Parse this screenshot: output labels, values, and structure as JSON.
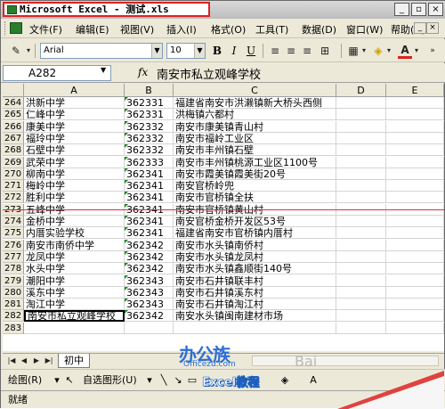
{
  "window": {
    "title": "Microsoft Excel - 测试.xls",
    "minimize": "_",
    "restore": "▫",
    "close": "×"
  },
  "menu": {
    "items": [
      {
        "label": "文件(F)"
      },
      {
        "label": "编辑(E)"
      },
      {
        "label": "视图(V)"
      },
      {
        "label": "插入(I)"
      },
      {
        "label": "格式(O)"
      },
      {
        "label": "工具(T)"
      },
      {
        "label": "数据(D)"
      },
      {
        "label": "窗口(W)"
      },
      {
        "label": "帮助(H)"
      }
    ]
  },
  "toolbar": {
    "font_name": "Arial",
    "font_size": "10",
    "bold": "B",
    "italic": "I",
    "underline": "U",
    "font_color_letter": "A"
  },
  "formula_bar": {
    "name_box": "A282",
    "fx_label": "fx",
    "formula": "南安市私立观峰学校"
  },
  "columns": [
    "A",
    "B",
    "C",
    "D",
    "E"
  ],
  "rows": [
    {
      "n": "264",
      "a": "洪新中学",
      "b": "362331",
      "c": "福建省南安市洪濑镇新大桥头西侧"
    },
    {
      "n": "265",
      "a": "仁峰中学",
      "b": "362331",
      "c": "洪梅镇六都村"
    },
    {
      "n": "266",
      "a": "康美中学",
      "b": "362332",
      "c": "南安市康美镇青山村"
    },
    {
      "n": "267",
      "a": "福玲中学",
      "b": "362332",
      "c": "南安市福岭工业区"
    },
    {
      "n": "268",
      "a": "石壁中学",
      "b": "362332",
      "c": "南安市丰州镇石壁"
    },
    {
      "n": "269",
      "a": "武荣中学",
      "b": "362333",
      "c": "南安市丰州镇桃源工业区1100号"
    },
    {
      "n": "270",
      "a": "柳南中学",
      "b": "362341",
      "c": "南安市霞美镇霞美街20号"
    },
    {
      "n": "271",
      "a": "梅岭中学",
      "b": "362341",
      "c": "南安官桥岭兜"
    },
    {
      "n": "272",
      "a": "胜利中学",
      "b": "362341",
      "c": "南安市官桥镇全扶"
    },
    {
      "n": "273",
      "a": "五峰中学",
      "b": "362341",
      "c": "南安市官桥镇黄山村"
    },
    {
      "n": "274",
      "a": "金桥中学",
      "b": "362341",
      "c": "南安官桥金桥开发区53号"
    },
    {
      "n": "275",
      "a": "内厝实验学校",
      "b": "362341",
      "c": "福建省南安市官桥镇内厝村"
    },
    {
      "n": "276",
      "a": "南安市南侨中学",
      "b": "362342",
      "c": "南安市水头镇南侨村"
    },
    {
      "n": "277",
      "a": "龙凤中学",
      "b": "362342",
      "c": "南安市水头镇龙凤村"
    },
    {
      "n": "278",
      "a": "水头中学",
      "b": "362342",
      "c": "南安市水头镇鑫顺街140号"
    },
    {
      "n": "279",
      "a": "潮阳中学",
      "b": "362343",
      "c": "南安市石井镇联丰村"
    },
    {
      "n": "280",
      "a": "溪东中学",
      "b": "362343",
      "c": "南安市石井镇溪东村"
    },
    {
      "n": "281",
      "a": "淘江中学",
      "b": "362343",
      "c": "南安市石井镇淘江村"
    },
    {
      "n": "282",
      "a": "南安市私立观峰学校",
      "b": "362342",
      "c": "南安水头镇闽南建材市场"
    },
    {
      "n": "283",
      "a": "",
      "b": "",
      "c": ""
    }
  ],
  "sheet_tabs": {
    "nav_first": "|◀",
    "nav_prev": "◀",
    "nav_next": "▶",
    "nav_last": "▶|",
    "active": "初中"
  },
  "watermark": {
    "logo": "办公族",
    "url": "Officezu.com",
    "faded": "Bai"
  },
  "drawing_toolbar": {
    "draw": "绘图(R)",
    "autoshapes": "自选图形(U)"
  },
  "badge": "Excel教程",
  "status": "就绪"
}
